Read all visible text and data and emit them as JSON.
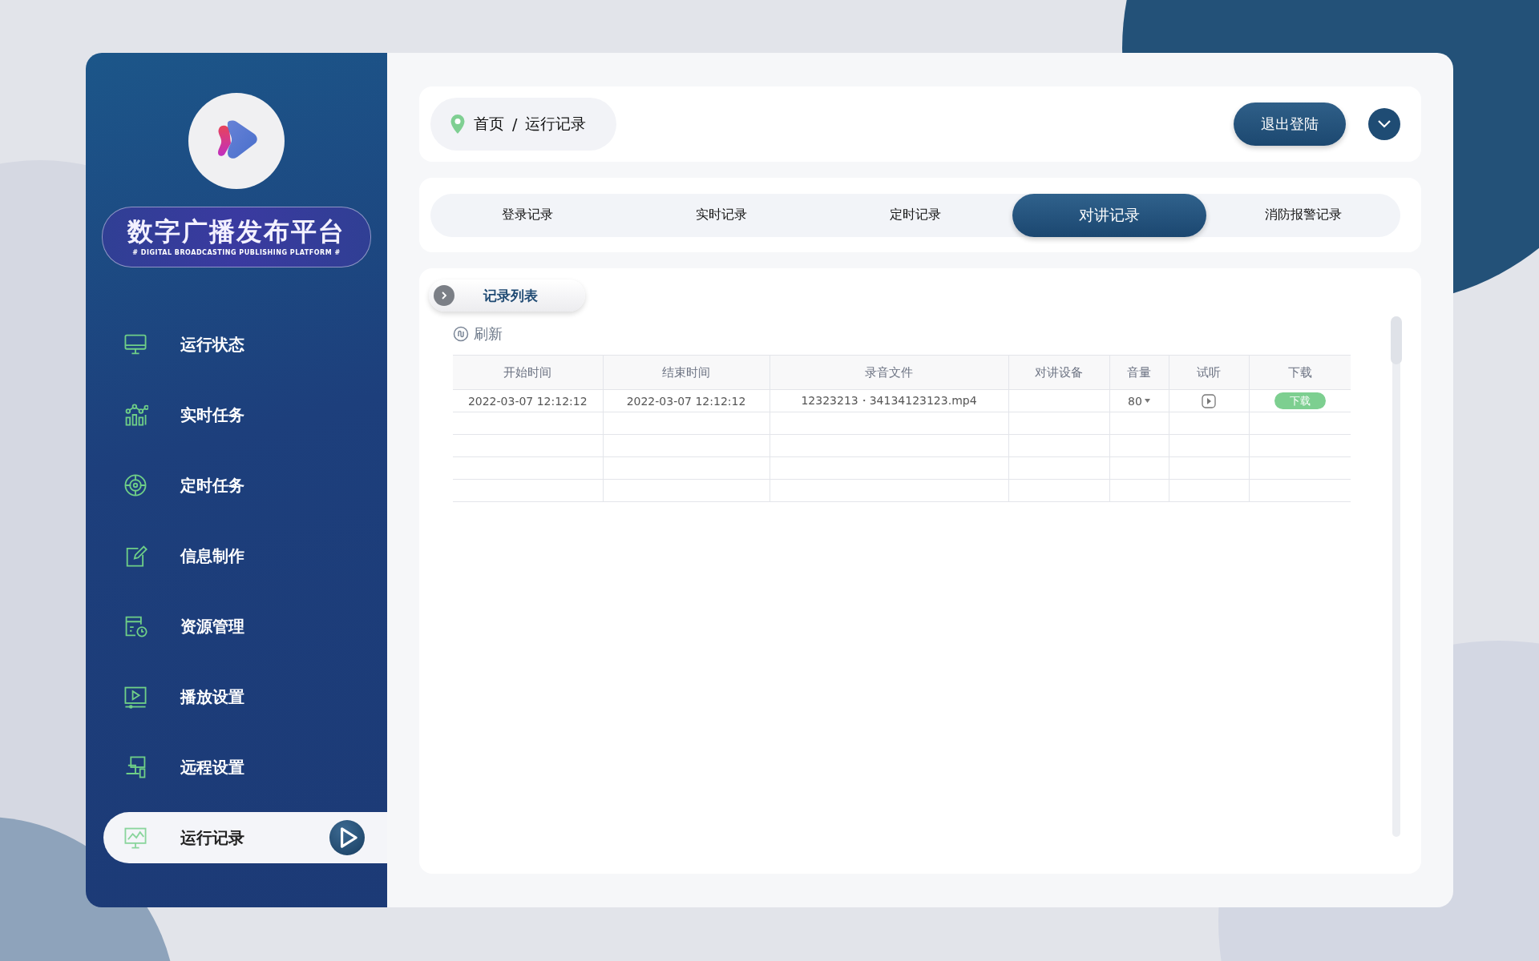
{
  "logo": {
    "title": "数字广播发布平台",
    "subtitle": "# DIGITAL BROADCASTING PUBLISHING PLATFORM #"
  },
  "sidebar": {
    "items": [
      {
        "label": "运行状态",
        "selected": false
      },
      {
        "label": "实时任务",
        "selected": false
      },
      {
        "label": "定时任务",
        "selected": false
      },
      {
        "label": "信息制作",
        "selected": false
      },
      {
        "label": "资源管理",
        "selected": false
      },
      {
        "label": "播放设置",
        "selected": false
      },
      {
        "label": "远程设置",
        "selected": false
      },
      {
        "label": "运行记录",
        "selected": true
      }
    ]
  },
  "header": {
    "breadcrumb": {
      "home": "首页",
      "separator": "/",
      "current": "运行记录"
    },
    "logout_button": "退出登陆"
  },
  "tabs": [
    {
      "label": "登录记录",
      "selected": false
    },
    {
      "label": "实时记录",
      "selected": false
    },
    {
      "label": "定时记录",
      "selected": false
    },
    {
      "label": "对讲记录",
      "selected": true
    },
    {
      "label": "消防报警记录",
      "selected": false
    }
  ],
  "records": {
    "title": "记录列表",
    "refresh": "刷新",
    "table": {
      "columns": [
        "开始时间",
        "结束时间",
        "录音文件",
        "对讲设备",
        "音量",
        "试听",
        "下载"
      ],
      "rows": [
        {
          "start": "2022-03-07 12:12:12",
          "end": "2022-03-07 12:12:12",
          "file": "12323213・34134123123.mp4",
          "volume": "80",
          "download": "下载"
        }
      ]
    }
  }
}
